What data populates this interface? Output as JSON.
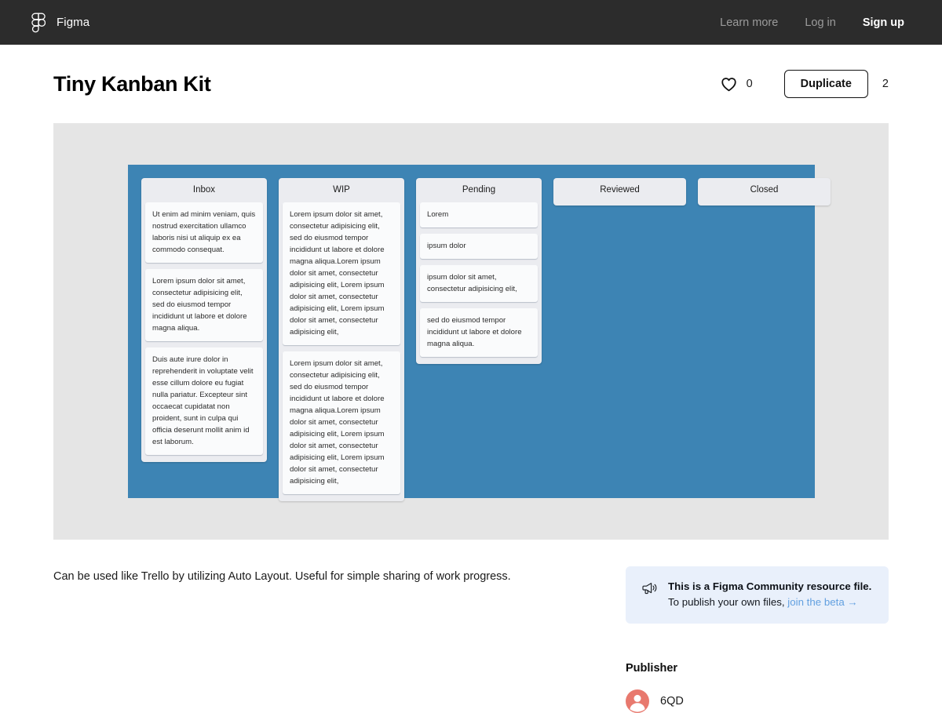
{
  "topbar": {
    "brand": "Figma",
    "logo_icon": "figma-logo-icon",
    "links": [
      {
        "label": "Learn more",
        "name": "nav-learn-more"
      },
      {
        "label": "Log in",
        "name": "nav-log-in"
      },
      {
        "label": "Sign up",
        "name": "nav-sign-up"
      }
    ]
  },
  "file": {
    "title": "Tiny Kanban Kit",
    "like_count": "0",
    "like_icon": "heart-icon",
    "duplicate_label": "Duplicate",
    "duplicate_count": "2"
  },
  "board": {
    "background_color": "#3d84b4",
    "canvas_color": "#e5e5e5",
    "columns": [
      {
        "title": "Inbox",
        "cards": [
          "Ut enim ad minim veniam, quis nostrud exercitation ullamco laboris nisi ut aliquip ex ea commodo consequat.",
          "Lorem ipsum dolor sit amet, consectetur adipisicing elit, sed do eiusmod tempor incididunt ut labore et dolore magna aliqua.",
          "Duis aute irure dolor in reprehenderit in voluptate velit esse cillum dolore eu fugiat nulla pariatur. Excepteur sint occaecat cupidatat non proident, sunt in culpa qui officia deserunt mollit anim id est laborum."
        ]
      },
      {
        "title": "WIP",
        "cards": [
          "Lorem ipsum dolor sit amet, consectetur adipisicing elit, sed do eiusmod tempor incididunt ut labore et dolore magna aliqua.Lorem ipsum dolor sit amet, consectetur adipisicing elit, Lorem ipsum dolor sit amet, consectetur adipisicing elit, Lorem ipsum dolor sit amet, consectetur adipisicing elit,",
          "Lorem ipsum dolor sit amet, consectetur adipisicing elit, sed do eiusmod tempor incididunt ut labore et dolore magna aliqua.Lorem ipsum dolor sit amet, consectetur adipisicing elit, Lorem ipsum dolor sit amet, consectetur adipisicing elit, Lorem ipsum dolor sit amet, consectetur adipisicing elit,"
        ]
      },
      {
        "title": "Pending",
        "cards": [
          "Lorem",
          "ipsum dolor",
          "ipsum dolor sit amet, consectetur adipisicing elit,",
          "sed do eiusmod tempor incididunt ut labore et dolore magna aliqua."
        ]
      },
      {
        "title": "Reviewed",
        "cards": []
      },
      {
        "title": "Closed",
        "cards": []
      }
    ]
  },
  "description": "Can be used like Trello by utilizing Auto Layout. Useful for simple sharing of work progress.",
  "notice": {
    "icon": "megaphone-icon",
    "title": "This is a Figma Community resource file.",
    "subtitle_prefix": "To publish your own files, ",
    "link_label": "join the beta →",
    "link_color": "#62a0e0",
    "background_color": "#e9f0fb"
  },
  "publisher": {
    "heading": "Publisher",
    "name": "6QD",
    "avatar_icon": "user-avatar-icon",
    "avatar_color": "#e8796e"
  }
}
